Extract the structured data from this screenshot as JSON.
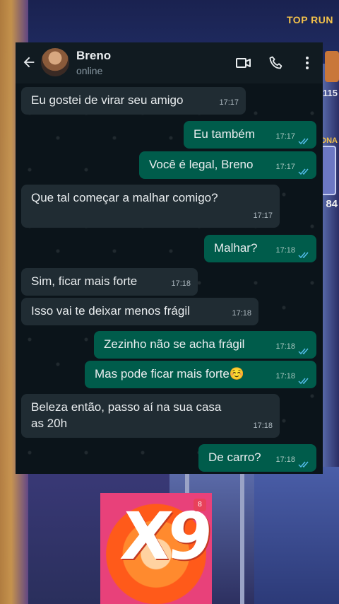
{
  "game": {
    "top_right_label": "TOP RUN",
    "score_1": "115",
    "label_2": "ONA",
    "score_2": "84"
  },
  "contact": {
    "name": "Breno",
    "status": "online"
  },
  "icons": {
    "back": "back-arrow-icon",
    "video": "video-call-icon",
    "phone": "phone-call-icon",
    "menu": "more-options-icon",
    "read": "double-check-read-icon"
  },
  "colors": {
    "incoming_bubble": "#202c33",
    "outgoing_bubble": "#005c4b",
    "read_ticks": "#53bdeb",
    "chat_bg": "#0b141a"
  },
  "messages": [
    {
      "dir": "in",
      "text": "Eu gostei de virar seu amigo",
      "time": "17:17"
    },
    {
      "dir": "out",
      "text": "Eu também",
      "time": "17:17"
    },
    {
      "dir": "out",
      "text": "Você é legal, Breno",
      "time": "17:17"
    },
    {
      "dir": "in",
      "text": "Que tal começar a malhar comigo?",
      "time": "17:17"
    },
    {
      "dir": "out",
      "text": "Malhar?",
      "time": "17:18"
    },
    {
      "dir": "in",
      "text": "Sim, ficar mais forte",
      "time": "17:18"
    },
    {
      "dir": "in",
      "text": "Isso vai te deixar menos frágil",
      "time": "17:18"
    },
    {
      "dir": "out",
      "text": "Zezinho não se acha frágil",
      "time": "17:18"
    },
    {
      "dir": "out",
      "text": "Mas pode ficar mais forte☺️",
      "time": "17:18"
    },
    {
      "dir": "in",
      "text": "Beleza então, passo aí na sua casa as 20h",
      "time": "17:18"
    },
    {
      "dir": "out",
      "text": "De carro?",
      "time": "17:18"
    }
  ],
  "logo": {
    "text": "X9",
    "badge": "8"
  }
}
